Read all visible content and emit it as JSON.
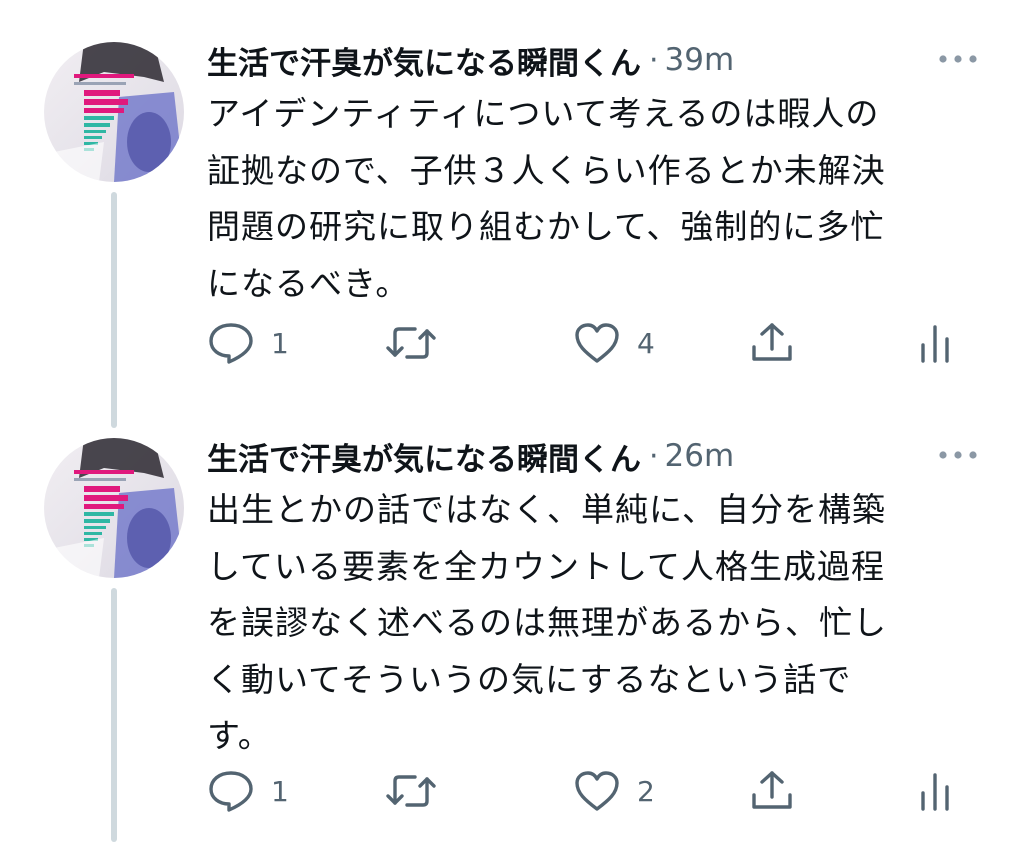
{
  "tweets": [
    {
      "author": "生活で汗臭が気になる瞬間くん",
      "separator": "·",
      "time": "39m",
      "lines": [
        "アイデンティティについて考えるのは暇人の",
        "証拠なので、子供３人くらい作るとか未解決",
        "問題の研究に取り組むかして、強制的に多忙",
        "になるべき。"
      ],
      "replies": "1",
      "likes": "4"
    },
    {
      "author": "生活で汗臭が気になる瞬間くん",
      "separator": "·",
      "time": "26m",
      "lines": [
        "出生とかの話ではなく、単純に、自分を構築",
        "している要素を全カウントして人格生成過程",
        "を誤謬なく述べるのは無理があるから、忙し",
        "く動いてそういうの気にするなという話で",
        "す。"
      ],
      "replies": "1",
      "likes": "2"
    }
  ],
  "icons": {
    "more": "more-dots-icon",
    "reply": "reply-bubble-icon",
    "retweet": "retweet-icon",
    "like": "heart-icon",
    "share": "share-upload-icon",
    "views": "analytics-bars-icon"
  },
  "colors": {
    "text_primary": "#0f1419",
    "text_secondary": "#536471",
    "thread_line": "#cfd9de",
    "avatar_accent": "#e0197d"
  }
}
